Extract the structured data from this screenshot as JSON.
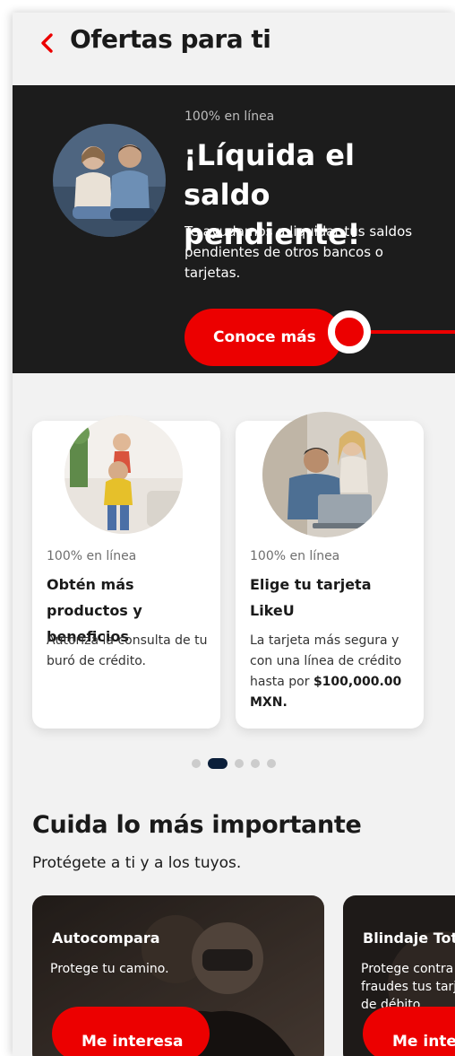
{
  "header": {
    "title": "Ofertas para ti",
    "back_icon": "chevron-left-icon"
  },
  "hero": {
    "tag": "100% en línea",
    "title": "¡Líquida el saldo pendiente!",
    "description": "Te ayudamos a liquidar tus saldos pendientes de otros bancos o tarjetas.",
    "cta_label": "Conoce más"
  },
  "offers": [
    {
      "tag": "100% en línea",
      "title": "Obtén más productos y beneficios",
      "description": "Autoriza la consulta de tu buró de crédito."
    },
    {
      "tag": "100% en línea",
      "title": "Elige tu tarjeta LikeU",
      "description": "La tarjeta más segura y con una línea de crédito hasta por",
      "description_bold": "$100,000.00 MXN."
    }
  ],
  "carousel": {
    "page_count": 5,
    "active_index": 1
  },
  "section": {
    "title": "Cuida lo más importante",
    "subtitle": "Protégete a ti y a los tuyos."
  },
  "insurance": [
    {
      "title": "Autocompara",
      "description": "Protege tu camino.",
      "cta_label": "Me interesa"
    },
    {
      "title": "Blindaje Total",
      "description": "Protege contra fraudes tus tarjetas de débito.",
      "cta_label": "Me interesa"
    }
  ],
  "colors": {
    "accent": "#ec0000",
    "hero_bg": "#1c1c1c",
    "page_bg": "#f2f2f2",
    "dot_active": "#0b1f3a"
  }
}
